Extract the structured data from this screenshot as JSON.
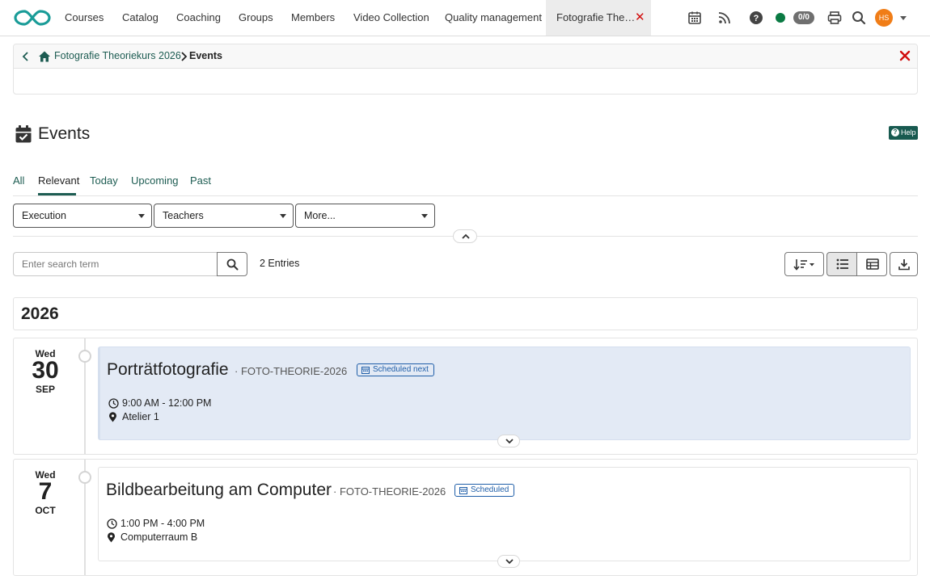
{
  "nav": {
    "items": [
      "Courses",
      "Catalog",
      "Coaching",
      "Groups",
      "Members",
      "Video Collection",
      "Quality management"
    ],
    "active_tab": "Fotografie The…",
    "online_badge": "0/0",
    "user_initials": "HS"
  },
  "breadcrumb": {
    "course": "Fotografie Theoriekurs 2026",
    "current": "Events"
  },
  "page": {
    "title": "Events",
    "help_label": "Help"
  },
  "tabs": [
    "All",
    "Relevant",
    "Today",
    "Upcoming",
    "Past"
  ],
  "filters": [
    "Execution",
    "Teachers",
    "More..."
  ],
  "search": {
    "placeholder": "Enter search term",
    "entries": "2 Entries"
  },
  "year": "2026",
  "events": [
    {
      "dow": "Wed",
      "day": "30",
      "month": "SEP",
      "title": "Porträtfotografie",
      "ref": "· FOTO-THEORIE-2026",
      "status": "Scheduled next",
      "time": "9:00 AM - 12:00 PM",
      "location": "Atelier 1"
    },
    {
      "dow": "Wed",
      "day": "7",
      "month": "OCT",
      "title": "Bildbearbeitung am Computer",
      "ref": "· FOTO-THEORIE-2026",
      "status": "Scheduled",
      "time": "1:00 PM - 4:00 PM",
      "location": "Computerraum B"
    }
  ],
  "colors": {
    "brand": "#1d5c52",
    "accent_blue": "#1f5ea8",
    "close_red": "#d10d0d",
    "avatar": "#f07d17",
    "online": "#0a7a43"
  }
}
